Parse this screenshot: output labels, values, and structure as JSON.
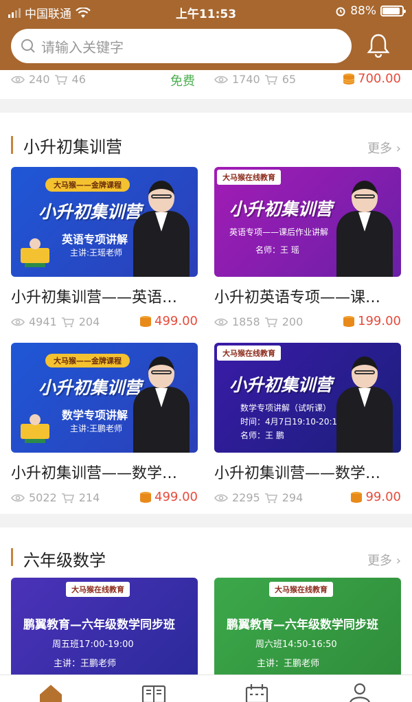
{
  "status": {
    "carrier": "中国联通",
    "time": "上午11:53",
    "battery": "88%",
    "battery_level": 0.88
  },
  "search": {
    "placeholder": "请输入关键字"
  },
  "prev_row": {
    "left": {
      "views": "240",
      "carts": "46",
      "price": "免费"
    },
    "right": {
      "views": "1740",
      "carts": "65",
      "price": "700.00"
    }
  },
  "sections": [
    {
      "title": "小升初集训营",
      "more": "更多",
      "courses": [
        {
          "title": "小升初集训营——英语…",
          "views": "4941",
          "carts": "204",
          "price": "499.00",
          "banner": {
            "tag": "大马猴——金牌课程",
            "big": "小升初集训营",
            "sub1": "英语专项讲解",
            "sub2": "主讲:王瑶老师"
          }
        },
        {
          "title": "小升初英语专项——课…",
          "views": "1858",
          "carts": "200",
          "price": "199.00",
          "banner": {
            "logo": "大马猴在线教育",
            "big": "小升初集训营",
            "sub1": "英语专项——课后作业讲解",
            "sub2": "名师：王  瑶"
          }
        },
        {
          "title": "小升初集训营——数学…",
          "views": "5022",
          "carts": "214",
          "price": "499.00",
          "banner": {
            "tag": "大马猴——金牌课程",
            "big": "小升初集训营",
            "sub1": "数学专项讲解",
            "sub2": "主讲:王鹏老师"
          }
        },
        {
          "title": "小升初集训营——数学…",
          "views": "2295",
          "carts": "294",
          "price": "99.00",
          "banner": {
            "logo": "大马猴在线教育",
            "big": "小升初集训营",
            "sub1": "数学专项讲解（试听课）",
            "sub2": "时间：4月7日19:10-20:10",
            "sub3": "名师：王  鹏"
          }
        }
      ]
    },
    {
      "title": "六年级数学",
      "more": "更多",
      "courses": [
        {
          "banner": {
            "logo": "大马猴在线教育",
            "big": "鹏翼教育—六年级数学同步班",
            "sub1": "周五班17:00-19:00",
            "sub2": "主讲：王鹏老师"
          }
        },
        {
          "banner": {
            "logo": "大马猴在线教育",
            "big": "鹏翼教育—六年级数学同步班",
            "sub1": "周六班14:50-16:50",
            "sub2": "主讲：王鹏老师"
          }
        }
      ]
    }
  ],
  "colors": {
    "header": "#a7672f",
    "price": "#e64b3c",
    "free": "#4caf50",
    "accent_bar": "#c5843d"
  },
  "tabbar": {
    "icons": [
      "home-icon",
      "book-icon",
      "calendar-icon",
      "user-icon"
    ]
  }
}
